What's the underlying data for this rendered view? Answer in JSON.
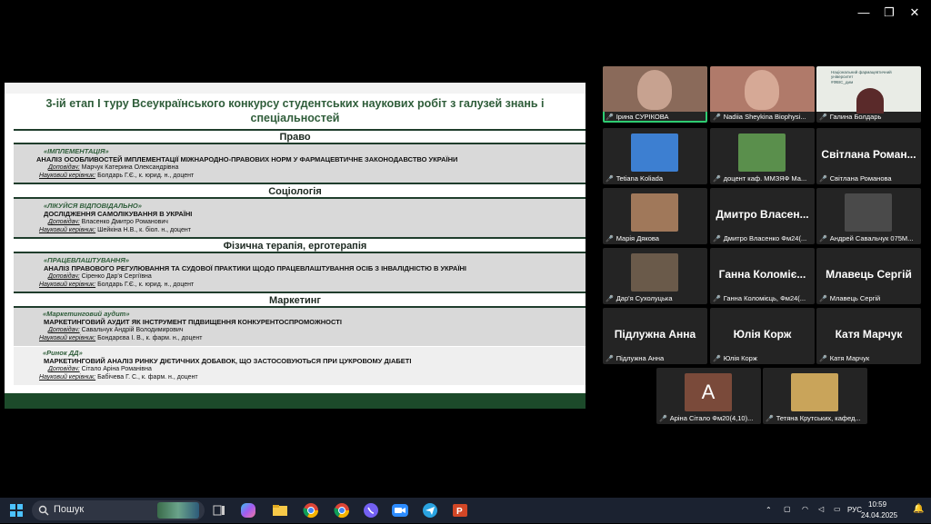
{
  "window": {
    "minimize": "—",
    "restore": "❐",
    "close": "✕"
  },
  "slide": {
    "title": "3-ій етап І туру Всеукраїнського конкурсу студентських наукових робіт з галузей знань і спеціальностей",
    "categories": [
      "Право",
      "Соціологія",
      "Фізична терапія, ерготерапія",
      "Маркетинг"
    ],
    "entries": [
      {
        "title": "«ІМПЛЕМЕНТАЦІЯ»",
        "subtitle": "АНАЛІЗ ОСОБЛИВОСТЕЙ ІМПЛЕМЕНТАЦІЇ МІЖНАРОДНО-ПРАВОВИХ НОРМ У ФАРМАЦЕВТИЧНЕ ЗАКОНОДАВСТВО УКРАЇНИ",
        "speaker_label": "Доповідач:",
        "speaker": "Марчук Катерина Олександрівна",
        "advisor_label": "Науковий керівник:",
        "advisor": "Болдарь Г.Є., к. юрид. н., доцент"
      },
      {
        "title": "«ЛІКУЙСЯ ВІДПОВІДАЛЬНО»",
        "subtitle": "ДОСЛІДЖЕННЯ САМОЛІКУВАННЯ В УКРАЇНІ",
        "speaker_label": "Доповідач:",
        "speaker": "Власенко Дмитро Романович",
        "advisor_label": "Науковий керівник:",
        "advisor": "Шейкіна Н.В., к. біол. н., доцент"
      },
      {
        "title": "«ПРАЦЕВЛАШТУВАННЯ»",
        "subtitle": "АНАЛІЗ ПРАВОВОГО РЕГУЛЮВАННЯ ТА СУДОВОЇ ПРАКТИКИ ЩОДО ПРАЦЕВЛАШТУВАННЯ ОСІБ З ІНВАЛІДНІСТЮ В УКРАЇНІ",
        "speaker_label": "Доповідач:",
        "speaker": "Сіренко Дар'я Сергіївна",
        "advisor_label": "Науковий керівник:",
        "advisor": "Болдарь Г.Є., к. юрид. н., доцент"
      },
      {
        "title": "«Маркетинговий аудит»",
        "subtitle": "МАРКЕТИНГОВИЙ АУДИТ ЯК ІНСТРУМЕНТ ПІДВИЩЕННЯ КОНКУРЕНТОСПРОМОЖНОСТІ",
        "speaker_label": "Доповідач:",
        "speaker": "Савальчук Андрій Володимирович",
        "advisor_label": "Науковий керівник:",
        "advisor": "Бондарєва І. В., к. фарм. н., доцент"
      },
      {
        "title": "«Ринок ДД»",
        "subtitle": "МАРКЕТИНГОВИЙ АНАЛІЗ РИНКУ ДІЄТИЧНИХ ДОБАВОК, ЩО ЗАСТОСОВУЮТЬСЯ ПРИ ЦУКРОВОМУ ДІАБЕТІ",
        "speaker_label": "Доповідач:",
        "speaker": "Сітало Аріна Романівна",
        "advisor_label": "Науковий керівник:",
        "advisor": "Бабічева Г. С., к. фарм. н., доцент"
      }
    ]
  },
  "participants": [
    {
      "label": "Ірина СУРІКОВА",
      "kind": "video",
      "color": "#8a6a5a",
      "active": true
    },
    {
      "label": "Nadiia Sheykina Biophysi...",
      "kind": "video",
      "color": "#b07a6a"
    },
    {
      "label": "Галина Болдарь",
      "kind": "video",
      "color": "#e9ece6",
      "slide_header": "Національний фармацевтичний університет",
      "slide_subheader": "#ФВІС_дим"
    },
    {
      "label": "Tetiana Koliada",
      "kind": "photo",
      "color": "#3d7fd1"
    },
    {
      "label": "доцент каф. ММЗЯФ Ма...",
      "kind": "photo",
      "color": "#5a8f4c"
    },
    {
      "label": "Світлана Романова",
      "kind": "name",
      "bigname": "Світлана Роман..."
    },
    {
      "label": "Марія Дякова",
      "kind": "photo",
      "color": "#a0785a"
    },
    {
      "label": "Дмитро Власенко Фм24(...",
      "kind": "name",
      "bigname": "Дмитро Власен..."
    },
    {
      "label": "Андрей Савальчук 075М...",
      "kind": "photo",
      "color": "#4a4a4a"
    },
    {
      "label": "Дар'я Сухолуцька",
      "kind": "photo",
      "color": "#6a5a4a"
    },
    {
      "label": "Ганна Коломієць, Фм24(...",
      "kind": "name",
      "bigname": "Ганна Коломіє..."
    },
    {
      "label": "Млавець Сергій",
      "kind": "name",
      "bigname": "Млавець Сергій"
    },
    {
      "label": "Підлужна Анна",
      "kind": "name",
      "bigname": "Підлужна Анна"
    },
    {
      "label": "Юлія Корж",
      "kind": "name",
      "bigname": "Юлія Корж"
    },
    {
      "label": "Катя Марчук",
      "kind": "name",
      "bigname": "Катя Марчук"
    },
    {
      "label": "Аріна Сітало Фм20(4,10)...",
      "kind": "letter",
      "letter": "A",
      "color": "#7a4a3a"
    },
    {
      "label": "Тетяна Крутських, кафед...",
      "kind": "photo",
      "color": "#c9a45a"
    }
  ],
  "taskbar": {
    "search_label": "Пошук",
    "language": "РУС",
    "time": "10:59",
    "date": "24.04.2025",
    "apps": [
      "start",
      "task-view",
      "copilot",
      "file-explorer",
      "chrome",
      "chrome-2",
      "viber",
      "zoom",
      "telegram",
      "powerpoint"
    ]
  }
}
